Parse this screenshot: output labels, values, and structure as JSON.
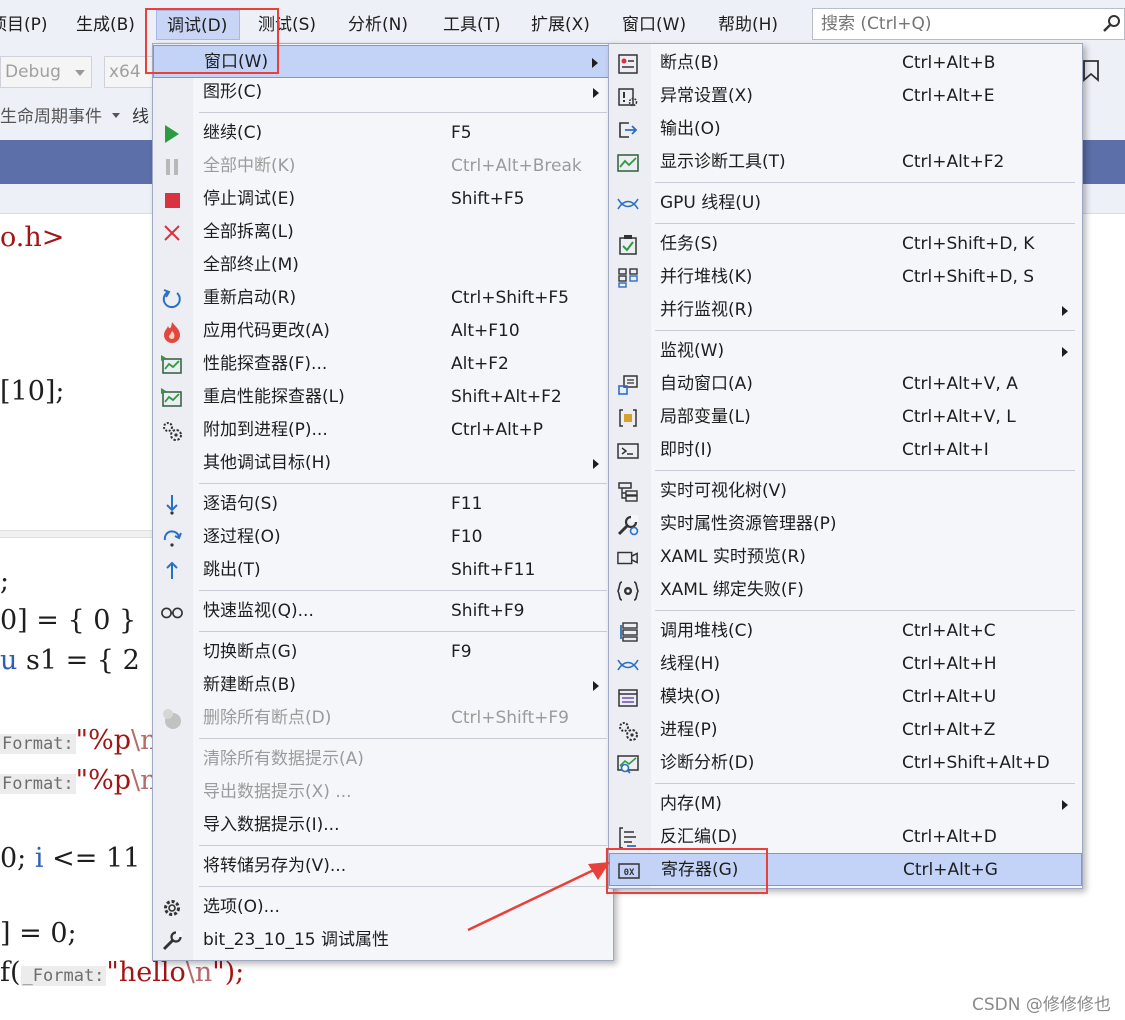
{
  "menubar": {
    "items": [
      {
        "label": "项目(P)"
      },
      {
        "label": "生成(B)"
      },
      {
        "label": "调试(D)"
      },
      {
        "label": "测试(S)"
      },
      {
        "label": "分析(N)"
      },
      {
        "label": "工具(T)"
      },
      {
        "label": "扩展(X)"
      },
      {
        "label": "窗口(W)"
      },
      {
        "label": "帮助(H)"
      }
    ],
    "search_placeholder": "搜索 (Ctrl+Q)"
  },
  "toolbar": {
    "config": "Debug",
    "platform": "x64",
    "lifecycle": "生命周期事件",
    "thread_label": "线"
  },
  "editor": {
    "line1": "o.h>",
    "line2": "[10];",
    "line3": ";",
    "line4a": "0] = { 0 }",
    "line5a": "u",
    "line5b": "s1 = { 2",
    "hint_format": "Format:",
    "str_p": "\"%p",
    "esc_n": "\\n\"",
    "line8a": "0;",
    "line8b": "i",
    "line8c": "<= 11",
    "line9": "] = 0;",
    "line10a": "f(",
    "hint_format2": "_Format:",
    "line10_str": "\"hello",
    "line10_esc": "\\n",
    "line10_end": "\");"
  },
  "debug_menu": {
    "items": [
      {
        "label": "窗口(W)",
        "shortcut": "",
        "submenu": true,
        "icon": "none"
      },
      {
        "label": "图形(C)",
        "shortcut": "",
        "submenu": true,
        "icon": "none"
      },
      {
        "label": "继续(C)",
        "shortcut": "F5",
        "icon": "play-icon"
      },
      {
        "label": "全部中断(K)",
        "shortcut": "Ctrl+Alt+Break",
        "disabled": true,
        "icon": "pause-icon"
      },
      {
        "label": "停止调试(E)",
        "shortcut": "Shift+F5",
        "icon": "stop-icon"
      },
      {
        "label": "全部拆离(L)",
        "shortcut": "",
        "icon": "detach-x-icon"
      },
      {
        "label": "全部终止(M)",
        "shortcut": "",
        "icon": "none"
      },
      {
        "label": "重新启动(R)",
        "shortcut": "Ctrl+Shift+F5",
        "icon": "restart-icon"
      },
      {
        "label": "应用代码更改(A)",
        "shortcut": "Alt+F10",
        "icon": "hot-reload-flame-icon"
      },
      {
        "label": "性能探查器(F)...",
        "shortcut": "Alt+F2",
        "icon": "profiler-icon"
      },
      {
        "label": "重启性能探查器(L)",
        "shortcut": "Shift+Alt+F2",
        "icon": "profiler-restart-icon"
      },
      {
        "label": "附加到进程(P)...",
        "shortcut": "Ctrl+Alt+P",
        "icon": "attach-gears-icon"
      },
      {
        "label": "其他调试目标(H)",
        "shortcut": "",
        "submenu": true,
        "icon": "none"
      },
      {
        "label": "逐语句(S)",
        "shortcut": "F11",
        "icon": "step-into-icon"
      },
      {
        "label": "逐过程(O)",
        "shortcut": "F10",
        "icon": "step-over-icon"
      },
      {
        "label": "跳出(T)",
        "shortcut": "Shift+F11",
        "icon": "step-out-icon"
      },
      {
        "label": "快速监视(Q)...",
        "shortcut": "Shift+F9",
        "icon": "glasses-icon"
      },
      {
        "label": "切换断点(G)",
        "shortcut": "F9",
        "icon": "none"
      },
      {
        "label": "新建断点(B)",
        "shortcut": "",
        "submenu": true,
        "icon": "none"
      },
      {
        "label": "删除所有断点(D)",
        "shortcut": "Ctrl+Shift+F9",
        "disabled": true,
        "icon": "delete-breakpoints-icon"
      },
      {
        "label": "清除所有数据提示(A)",
        "shortcut": "",
        "disabled": true,
        "icon": "none"
      },
      {
        "label": "导出数据提示(X) ...",
        "shortcut": "",
        "disabled": true,
        "icon": "none"
      },
      {
        "label": "导入数据提示(I)...",
        "shortcut": "",
        "icon": "none"
      },
      {
        "label": "将转储另存为(V)...",
        "shortcut": "",
        "icon": "none"
      },
      {
        "label": "选项(O)...",
        "shortcut": "",
        "icon": "gear-icon"
      },
      {
        "label": "bit_23_10_15 调试属性",
        "shortcut": "",
        "icon": "wrench-icon"
      }
    ]
  },
  "window_menu": {
    "items": [
      {
        "label": "断点(B)",
        "shortcut": "Ctrl+Alt+B",
        "icon": "breakpoints-window-icon"
      },
      {
        "label": "异常设置(X)",
        "shortcut": "Ctrl+Alt+E",
        "icon": "exception-settings-icon"
      },
      {
        "label": "输出(O)",
        "shortcut": "",
        "icon": "output-icon"
      },
      {
        "label": "显示诊断工具(T)",
        "shortcut": "Ctrl+Alt+F2",
        "icon": "diagnostic-tools-icon"
      },
      {
        "label": "GPU 线程(U)",
        "shortcut": "",
        "icon": "gpu-threads-icon"
      },
      {
        "label": "任务(S)",
        "shortcut": "Ctrl+Shift+D, K",
        "icon": "tasks-icon"
      },
      {
        "label": "并行堆栈(K)",
        "shortcut": "Ctrl+Shift+D, S",
        "icon": "parallel-stacks-icon"
      },
      {
        "label": "并行监视(R)",
        "shortcut": "",
        "submenu": true,
        "icon": "none"
      },
      {
        "label": "监视(W)",
        "shortcut": "",
        "submenu": true,
        "icon": "none"
      },
      {
        "label": "自动窗口(A)",
        "shortcut": "Ctrl+Alt+V, A",
        "icon": "autos-icon"
      },
      {
        "label": "局部变量(L)",
        "shortcut": "Ctrl+Alt+V, L",
        "icon": "locals-icon"
      },
      {
        "label": "即时(I)",
        "shortcut": "Ctrl+Alt+I",
        "icon": "immediate-window-icon"
      },
      {
        "label": "实时可视化树(V)",
        "shortcut": "",
        "icon": "visual-tree-icon"
      },
      {
        "label": "实时属性资源管理器(P)",
        "shortcut": "",
        "icon": "property-explorer-icon"
      },
      {
        "label": "XAML 实时预览(R)",
        "shortcut": "",
        "icon": "xaml-preview-icon"
      },
      {
        "label": "XAML 绑定失败(F)",
        "shortcut": "",
        "icon": "xaml-binding-failure-icon"
      },
      {
        "label": "调用堆栈(C)",
        "shortcut": "Ctrl+Alt+C",
        "icon": "call-stack-icon"
      },
      {
        "label": "线程(H)",
        "shortcut": "Ctrl+Alt+H",
        "icon": "threads-icon"
      },
      {
        "label": "模块(O)",
        "shortcut": "Ctrl+Alt+U",
        "icon": "modules-icon"
      },
      {
        "label": "进程(P)",
        "shortcut": "Ctrl+Alt+Z",
        "icon": "processes-gears-icon"
      },
      {
        "label": "诊断分析(D)",
        "shortcut": "Ctrl+Shift+Alt+D",
        "icon": "diagnostic-analysis-icon"
      },
      {
        "label": "内存(M)",
        "shortcut": "",
        "submenu": true,
        "icon": "none"
      },
      {
        "label": "反汇编(D)",
        "shortcut": "Ctrl+Alt+D",
        "icon": "disassembly-icon"
      },
      {
        "label": "寄存器(G)",
        "shortcut": "Ctrl+Alt+G",
        "icon": "registers-0x-icon",
        "highlighted": true
      }
    ]
  },
  "watermark": "CSDN @修修修也",
  "colors": {
    "highlight": "#c3d3f7",
    "annotation_red": "#e8403a",
    "menubar_bg": "#eef0f7"
  }
}
